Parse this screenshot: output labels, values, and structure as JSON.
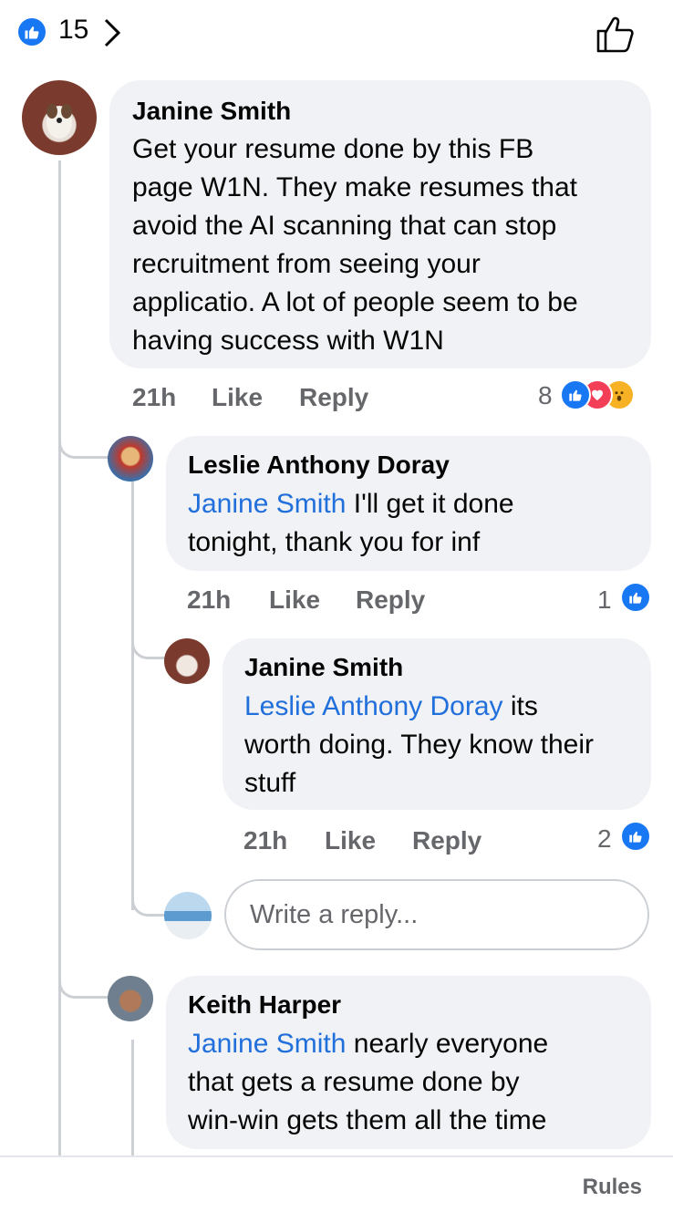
{
  "header": {
    "like_count": "15"
  },
  "comments": [
    {
      "author": "Janine Smith",
      "text": "Get your resume done by this FB page W1N. They make resumes that avoid the AI scanning that can stop recruitment from seeing your applicatio. A lot of people seem to be having success with W1N",
      "lines": [
        "Get your resume done by this FB",
        "page W1N. They make resumes that",
        "avoid the AI scanning that can stop",
        "recruitment from seeing your",
        "applicatio. A lot of people seem to be",
        "having success with W1N"
      ],
      "time": "21h",
      "like_label": "Like",
      "reply_label": "Reply",
      "reaction_count": "8",
      "reactions": [
        "like-icon",
        "heart-icon",
        "wow-icon"
      ]
    },
    {
      "author": "Leslie Anthony Doray",
      "mention": "Janine Smith",
      "line1_rest": " I'll get it done",
      "line2": "tonight, thank you for inf",
      "time": "21h",
      "like_label": "Like",
      "reply_label": "Reply",
      "reaction_count": "1"
    },
    {
      "author": "Janine Smith",
      "mention": "Leslie Anthony Doray",
      "line1_rest": " its",
      "line2": "worth doing. They know their",
      "line3": "stuff",
      "time": "21h",
      "like_label": "Like",
      "reply_label": "Reply",
      "reaction_count": "2"
    },
    {
      "author": "Keith Harper",
      "mention": "Janine Smith",
      "line1_rest": " nearly everyone",
      "line2": "that gets a resume done by",
      "line3": "win-win gets them all the time"
    }
  ],
  "reply_box": {
    "placeholder": "Write a reply..."
  },
  "footer": {
    "rules_label": "Rules"
  },
  "colors": {
    "accent": "#1877f2",
    "mention": "#216fdb",
    "bubble": "#f0f2f5",
    "meta": "#65676b"
  }
}
